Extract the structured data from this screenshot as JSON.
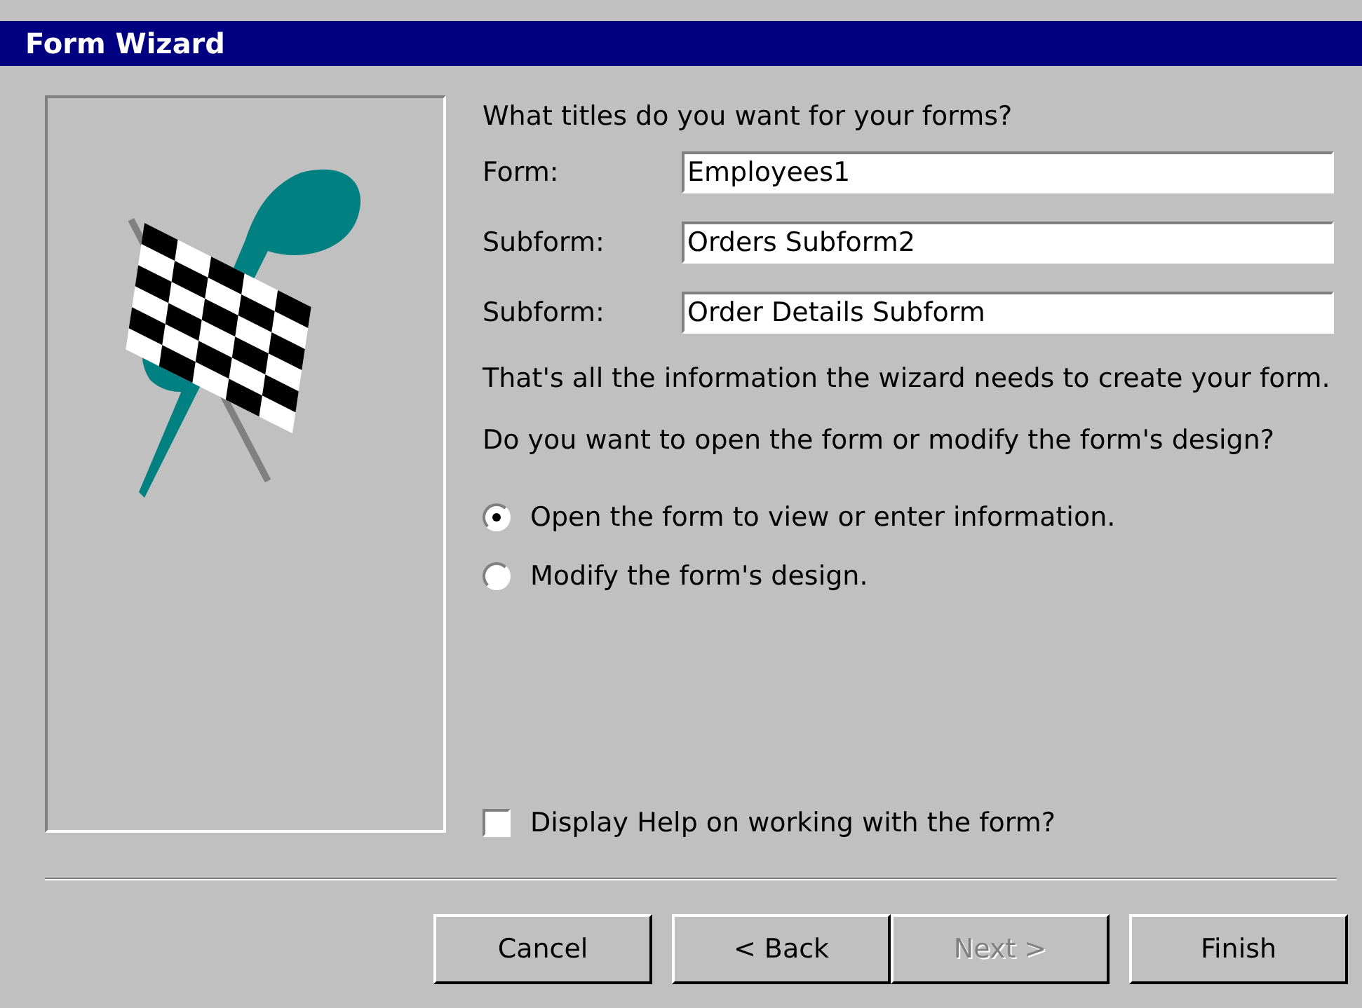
{
  "window": {
    "title": "Form Wizard"
  },
  "question": "What titles do you want for your forms?",
  "fields": [
    {
      "label": "Form:",
      "value": "Employees1"
    },
    {
      "label": "Subform:",
      "value": "Orders Subform2"
    },
    {
      "label": "Subform:",
      "value": "Order Details Subform"
    }
  ],
  "info": "That's all the information the wizard needs to create your form.",
  "prompt": "Do you want to open the form or modify the form's design?",
  "options": [
    {
      "label": "Open the form to view or enter information.",
      "selected": true
    },
    {
      "label": "Modify the form's design.",
      "selected": false
    }
  ],
  "help_checkbox": {
    "label": "Display Help on working with the form?",
    "checked": false
  },
  "buttons": [
    {
      "label": "Cancel",
      "disabled": false
    },
    {
      "label": "< Back",
      "disabled": false
    },
    {
      "label": "Next >",
      "disabled": true
    },
    {
      "label": "Finish",
      "disabled": false
    }
  ]
}
